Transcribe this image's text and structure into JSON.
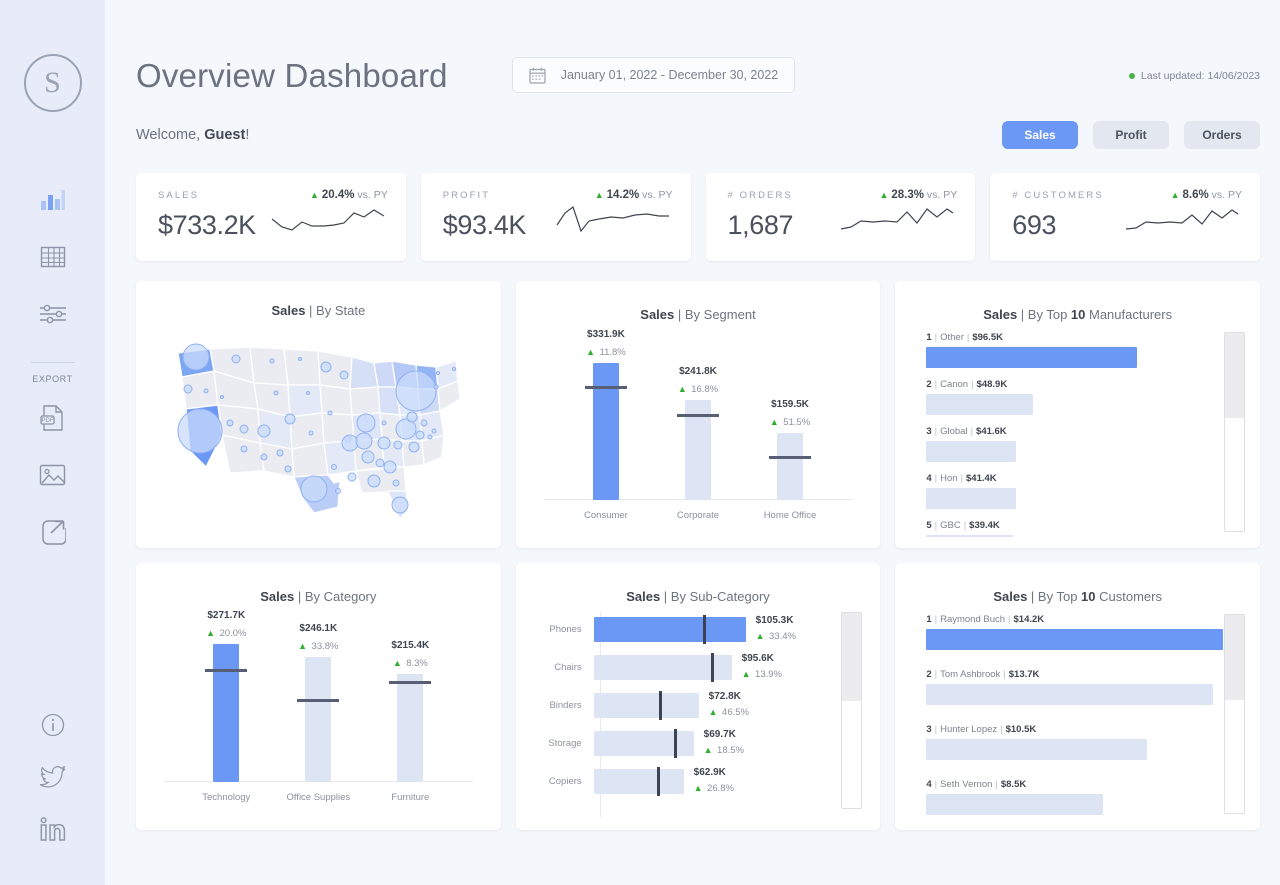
{
  "sidebar": {
    "logo_text": "S",
    "nav": [
      {
        "name": "charts-icon",
        "active": true
      },
      {
        "name": "table-icon",
        "active": false
      },
      {
        "name": "filters-icon",
        "active": false
      }
    ],
    "export_label": "EXPORT",
    "export_items": [
      "pdf-export-icon",
      "image-export-icon",
      "share-link-icon"
    ],
    "social": [
      "info-icon",
      "twitter-icon",
      "linkedin-icon"
    ]
  },
  "header": {
    "title": "Overview Dashboard",
    "date_range": "January 01, 2022 - December 30, 2022",
    "last_updated": "Last updated: 14/06/2023",
    "welcome_prefix": "Welcome, ",
    "welcome_name": "Guest",
    "welcome_suffix": "!",
    "toggles": [
      {
        "label": "Sales",
        "active": true
      },
      {
        "label": "Profit",
        "active": false
      },
      {
        "label": "Orders",
        "active": false
      }
    ]
  },
  "kpis": [
    {
      "label": "SALES",
      "value": "$733.2K",
      "delta": "20.4%",
      "delta_suffix": "vs. PY",
      "trend": "up"
    },
    {
      "label": "PROFIT",
      "value": "$93.4K",
      "delta": "14.2%",
      "delta_suffix": "vs. PY",
      "trend": "up"
    },
    {
      "label": "# ORDERS",
      "value": "1,687",
      "delta": "28.3%",
      "delta_suffix": "vs. PY",
      "trend": "up"
    },
    {
      "label": "# CUSTOMERS",
      "value": "693",
      "delta": "8.6%",
      "delta_suffix": "vs. PY",
      "trend": "up"
    }
  ],
  "colors": {
    "accent": "#6b97f5",
    "muted_bar": "#dde4f3",
    "positive": "#2fb02f",
    "page_bg": "#f4f7fb",
    "sidebar_bg": "#e7ecf8"
  },
  "cards": {
    "by_state": {
      "title_bold": "Sales",
      "title_rest": " | By State"
    },
    "by_segment": {
      "title_bold": "Sales",
      "title_rest": " | By Segment"
    },
    "by_manufacturer": {
      "title_bold": "Sales",
      "title_pre": " | By Top ",
      "title_num": "10",
      "title_post": " Manufacturers"
    },
    "by_category": {
      "title_bold": "Sales",
      "title_rest": " | By Category"
    },
    "by_subcategory": {
      "title_bold": "Sales",
      "title_rest": " | By Sub-Category"
    },
    "by_customer": {
      "title_bold": "Sales",
      "title_pre": " | By Top ",
      "title_num": "10",
      "title_post": " Customers"
    }
  },
  "chart_data": [
    {
      "id": "by_state",
      "type": "map",
      "title": "Sales | By State",
      "region": "United States",
      "encoding": "choropleth with proportional bubbles",
      "notes": "State fills shaded light blue by sales; circle markers sized by sales per state"
    },
    {
      "id": "by_segment",
      "type": "bar",
      "title": "Sales | By Segment",
      "categories": [
        "Consumer",
        "Corporate",
        "Home Office"
      ],
      "values": [
        331900,
        241800,
        159500
      ],
      "value_labels": [
        "$331.9K",
        "$241.8K",
        "$159.5K"
      ],
      "delta_labels": [
        "11.8%",
        "16.8%",
        "51.5%"
      ],
      "deltas": [
        11.8,
        16.8,
        51.5
      ],
      "reference_lines": [
        296900,
        207000,
        105300
      ],
      "highlighted_index": 0,
      "ylim": [
        0,
        340000
      ],
      "xlabel": "",
      "ylabel": "",
      "grid": false,
      "legend": "none"
    },
    {
      "id": "by_manufacturer",
      "type": "bar",
      "orientation": "horizontal",
      "title": "Sales | By Top 10 Manufacturers",
      "categories": [
        "Other",
        "Canon",
        "Global",
        "Hon",
        "GBC"
      ],
      "ranks": [
        1,
        2,
        3,
        4,
        5
      ],
      "values": [
        96500,
        48900,
        41600,
        41400,
        39400
      ],
      "value_labels": [
        "$96.5K",
        "$48.9K",
        "$41.6K",
        "$41.4K",
        "$39.4K"
      ],
      "highlighted_index": 0,
      "scroll_position": "top",
      "total_items": 10,
      "visible_items": 5
    },
    {
      "id": "by_category",
      "type": "bar",
      "title": "Sales | By Category",
      "categories": [
        "Technology",
        "Office Supplies",
        "Furniture"
      ],
      "values": [
        271700,
        246100,
        215400
      ],
      "value_labels": [
        "$271.7K",
        "$246.1K",
        "$215.4K"
      ],
      "delta_labels": [
        "20.0%",
        "33.8%",
        "8.3%"
      ],
      "deltas": [
        20.0,
        33.8,
        8.3
      ],
      "reference_lines": [
        226400,
        184000,
        196000
      ],
      "highlighted_index": 0,
      "ylim": [
        0,
        290000
      ],
      "xlabel": "",
      "ylabel": "",
      "grid": false,
      "legend": "none"
    },
    {
      "id": "by_subcategory",
      "type": "bar",
      "orientation": "horizontal",
      "title": "Sales | By Sub-Category",
      "categories": [
        "Phones",
        "Chairs",
        "Binders",
        "Storage",
        "Copiers"
      ],
      "values": [
        105300,
        95600,
        72800,
        69700,
        62900
      ],
      "value_labels": [
        "$105.3K",
        "$95.6K",
        "$72.8K",
        "$69.7K",
        "$62.9K"
      ],
      "delta_labels": [
        "33.4%",
        "13.9%",
        "46.5%",
        "18.5%",
        "26.8%"
      ],
      "deltas": [
        33.4,
        13.9,
        46.5,
        18.5,
        26.8
      ],
      "target_ticks": [
        78900,
        81500,
        47000,
        56000,
        47500
      ],
      "highlighted_index": 0,
      "scroll_position": "top",
      "total_items": 17,
      "visible_items": 5
    },
    {
      "id": "by_customer",
      "type": "bar",
      "orientation": "horizontal",
      "title": "Sales | By Top 10 Customers",
      "categories": [
        "Raymond Buch",
        "Tom Ashbrook",
        "Hunter Lopez",
        "Seth Vernon"
      ],
      "ranks": [
        1,
        2,
        3,
        4
      ],
      "values": [
        14200,
        13700,
        10500,
        8500
      ],
      "value_labels": [
        "$14.2K",
        "$13.7K",
        "$10.5K",
        "$8.5K"
      ],
      "highlighted_index": 0,
      "scroll_position": "top",
      "total_items": 10,
      "visible_items": 4
    }
  ]
}
